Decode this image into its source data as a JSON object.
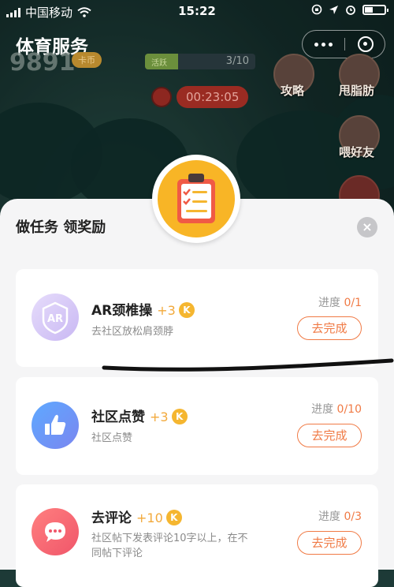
{
  "status_bar": {
    "carrier": "中国移动",
    "time": "15:22"
  },
  "header": {
    "title": "体育服务"
  },
  "game": {
    "score": "9891",
    "coin_label": "卡币",
    "progress_label": "活跃",
    "progress_value": "3/10",
    "progress_fraction": 0.3,
    "timer": "00:23:05",
    "side_buttons": [
      {
        "label": "攻略"
      },
      {
        "label": "甩脂肪"
      },
      {
        "label": "喂好友"
      }
    ]
  },
  "modal": {
    "title": "做任务 领奖励",
    "close_glyph": "×",
    "tasks": [
      {
        "name": "AR颈椎操",
        "points": "+3",
        "coin": "K",
        "desc": "去社区放松肩颈脖",
        "progress_label": "进度",
        "progress": "0/1",
        "button": "去完成",
        "icon_text": "AR"
      },
      {
        "name": "社区点赞",
        "points": "+3",
        "coin": "K",
        "desc": "社区点赞",
        "progress_label": "进度",
        "progress": "0/10",
        "button": "去完成"
      },
      {
        "name": "去评论",
        "points": "+10",
        "coin": "K",
        "desc": "社区帖下发表评论10字以上，在不同帖下评论",
        "progress_label": "进度",
        "progress": "0/3",
        "button": "去完成"
      }
    ]
  },
  "colors": {
    "accent": "#f07a45",
    "coin": "#f5b630",
    "modal_bg": "#f5f5f6"
  }
}
